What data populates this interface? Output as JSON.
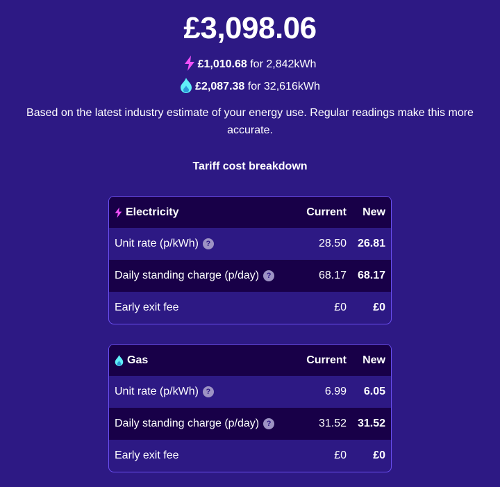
{
  "summary": {
    "total": "£3,098.06",
    "electricity_amount": "£1,010.68",
    "electricity_usage": "for 2,842kWh",
    "gas_amount": "£2,087.38",
    "gas_usage": "for 32,616kWh",
    "description": "Based on the latest industry estimate of your energy use. Regular readings make this more accurate."
  },
  "breakdown_title": "Tariff cost breakdown",
  "electricity": {
    "icon": "lightning-bolt-icon",
    "title": "Electricity",
    "col_current": "Current",
    "col_new": "New",
    "rows": [
      {
        "label": "Unit rate (p/kWh)",
        "help": "?",
        "current": "28.50",
        "new": "26.81"
      },
      {
        "label": "Daily standing charge (p/day)",
        "help": "?",
        "current": "68.17",
        "new": "68.17"
      },
      {
        "label": "Early exit fee",
        "current": "£0",
        "new": "£0"
      }
    ]
  },
  "gas": {
    "icon": "flame-icon",
    "title": "Gas",
    "col_current": "Current",
    "col_new": "New",
    "rows": [
      {
        "label": "Unit rate (p/kWh)",
        "help": "?",
        "current": "6.99",
        "new": "6.05"
      },
      {
        "label": "Daily standing charge (p/day)",
        "help": "?",
        "current": "31.52",
        "new": "31.52"
      },
      {
        "label": "Early exit fee",
        "current": "£0",
        "new": "£0"
      }
    ]
  },
  "colors": {
    "background": "#2d1984",
    "row_dark": "#180048",
    "card_border": "#6b4ff2",
    "electricity_accent": "#f050f8",
    "gas_accent": "#60f0f8"
  }
}
